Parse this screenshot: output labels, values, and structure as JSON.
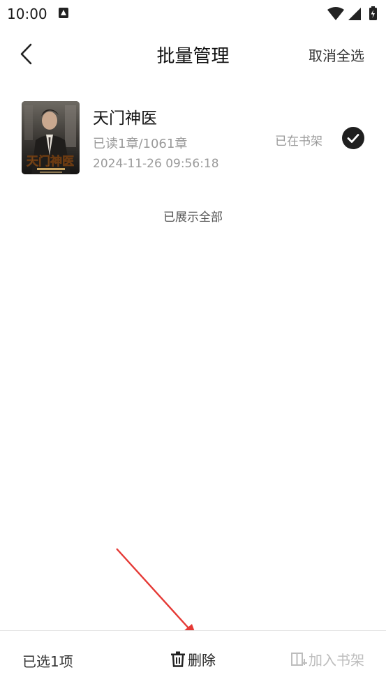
{
  "status_bar": {
    "time": "10:00"
  },
  "header": {
    "title": "批量管理",
    "cancel_select_all": "取消全选"
  },
  "books": [
    {
      "title": "天门神医",
      "progress": "已读1章/1061章",
      "last_read": "2024-11-26 09:56:18",
      "shelf_status": "已在书架",
      "selected": true,
      "cover_text": "天门神医"
    }
  ],
  "list_end_hint": "已展示全部",
  "bottom_bar": {
    "selected_count": "已选1项",
    "delete_label": "删除",
    "add_to_shelf_label": "加入书架"
  },
  "colors": {
    "accent_dark": "#1f1f1f",
    "annotation_arrow": "#e53935",
    "disabled_text": "#bdbdbd"
  }
}
